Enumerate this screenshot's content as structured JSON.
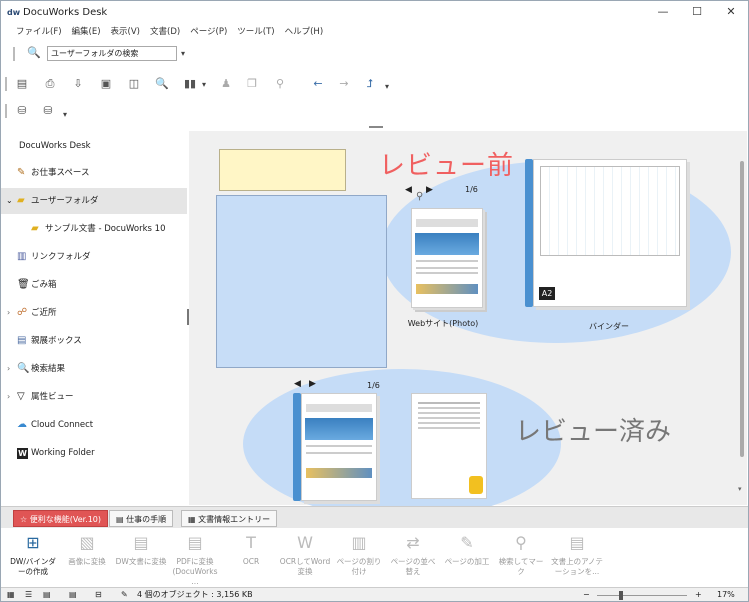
{
  "app": {
    "title": "DocuWorks Desk",
    "logo": "dw"
  },
  "window_controls": [
    "—",
    "☐",
    "✕"
  ],
  "menu": [
    "ファイル(F)",
    "編集(E)",
    "表示(V)",
    "文書(D)",
    "ページ(P)",
    "ツール(T)",
    "ヘルプ(H)"
  ],
  "search": {
    "placeholder": "ユーザーフォルダの検索",
    "value": "ユーザーフォルダの検索"
  },
  "sidebar": {
    "items": [
      {
        "label": "DocuWorks Desk",
        "icon": "none"
      },
      {
        "label": "お仕事スペース",
        "icon": "workspace-icon"
      },
      {
        "label": "ユーザーフォルダ",
        "icon": "folder-icon"
      },
      {
        "label": "サンプル文書 - DocuWorks 10",
        "icon": "folder-icon"
      },
      {
        "label": "リンクフォルダ",
        "icon": "link-folder-icon"
      },
      {
        "label": "ごみ箱",
        "icon": "trash-icon"
      },
      {
        "label": "ご近所",
        "icon": "neighbor-icon"
      },
      {
        "label": "親展ボックス",
        "icon": "inbox-icon"
      },
      {
        "label": "検索結果",
        "icon": "search-icon"
      },
      {
        "label": "属性ビュー",
        "icon": "filter-icon"
      },
      {
        "label": "Cloud Connect",
        "icon": "cloud-icon"
      },
      {
        "label": "Working Folder",
        "icon": "w-icon"
      }
    ]
  },
  "workspace": {
    "annotation_before": "レビュー前",
    "annotation_after": "レビュー済み",
    "doc_website": {
      "label": "Webサイト(Photo)",
      "page": "1/6"
    },
    "doc_binder": {
      "label": "バインダー",
      "badge": "A2"
    },
    "doc_bottom": {
      "page": "1/6"
    }
  },
  "bottom_tabs": [
    "便利な機能(Ver.10)",
    "仕事の手順",
    "文書情報エントリー"
  ],
  "ribbon": [
    {
      "label": "DW/バインダーの作成"
    },
    {
      "label": "画像に変換"
    },
    {
      "label": "DW文書に変換"
    },
    {
      "label": "PDFに変換(DocuWorks ..."
    },
    {
      "label": "OCR"
    },
    {
      "label": "OCRしてWord変換"
    },
    {
      "label": "ページの割り付け"
    },
    {
      "label": "ページの並べ替え"
    },
    {
      "label": "ページの加工"
    },
    {
      "label": "検索してマーク"
    },
    {
      "label": "文書上のアノテーションを..."
    }
  ],
  "status": {
    "objects": "4 個のオブジェクト : 3,156 KB",
    "zoom": "17%"
  },
  "colors": {
    "accent": "#e05555",
    "blue_zone": "#c5dcf7",
    "sticky": "#fff6c6"
  }
}
